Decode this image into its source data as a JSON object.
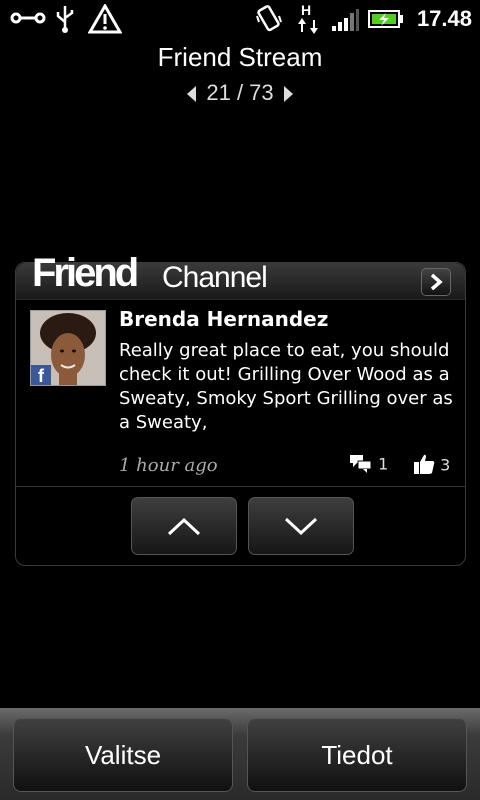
{
  "status_bar": {
    "time": "17.48",
    "icons": [
      "usb-debug-icon",
      "usb-icon",
      "warning-icon",
      "vibrate-icon",
      "hspa-data-icon",
      "signal-icon",
      "battery-charging-icon"
    ]
  },
  "header": {
    "title": "Friend Stream",
    "pager": "21 / 73"
  },
  "widget": {
    "brand_friend": "Friend",
    "brand_channel": "Channel",
    "post": {
      "author": "Brenda Hernandez",
      "message": "Really great place to eat, you should check it out! Grilling Over Wood as a Sweaty, Smoky Sport Grilling over as a Sweaty,",
      "time": "1 hour ago",
      "comments": "1",
      "likes": "3",
      "source_badge": "f"
    }
  },
  "softkeys": {
    "left": "Valitse",
    "right": "Tiedot"
  },
  "colors": {
    "background": "#000000",
    "facebook": "#3b5998",
    "battery": "#55cc22"
  }
}
